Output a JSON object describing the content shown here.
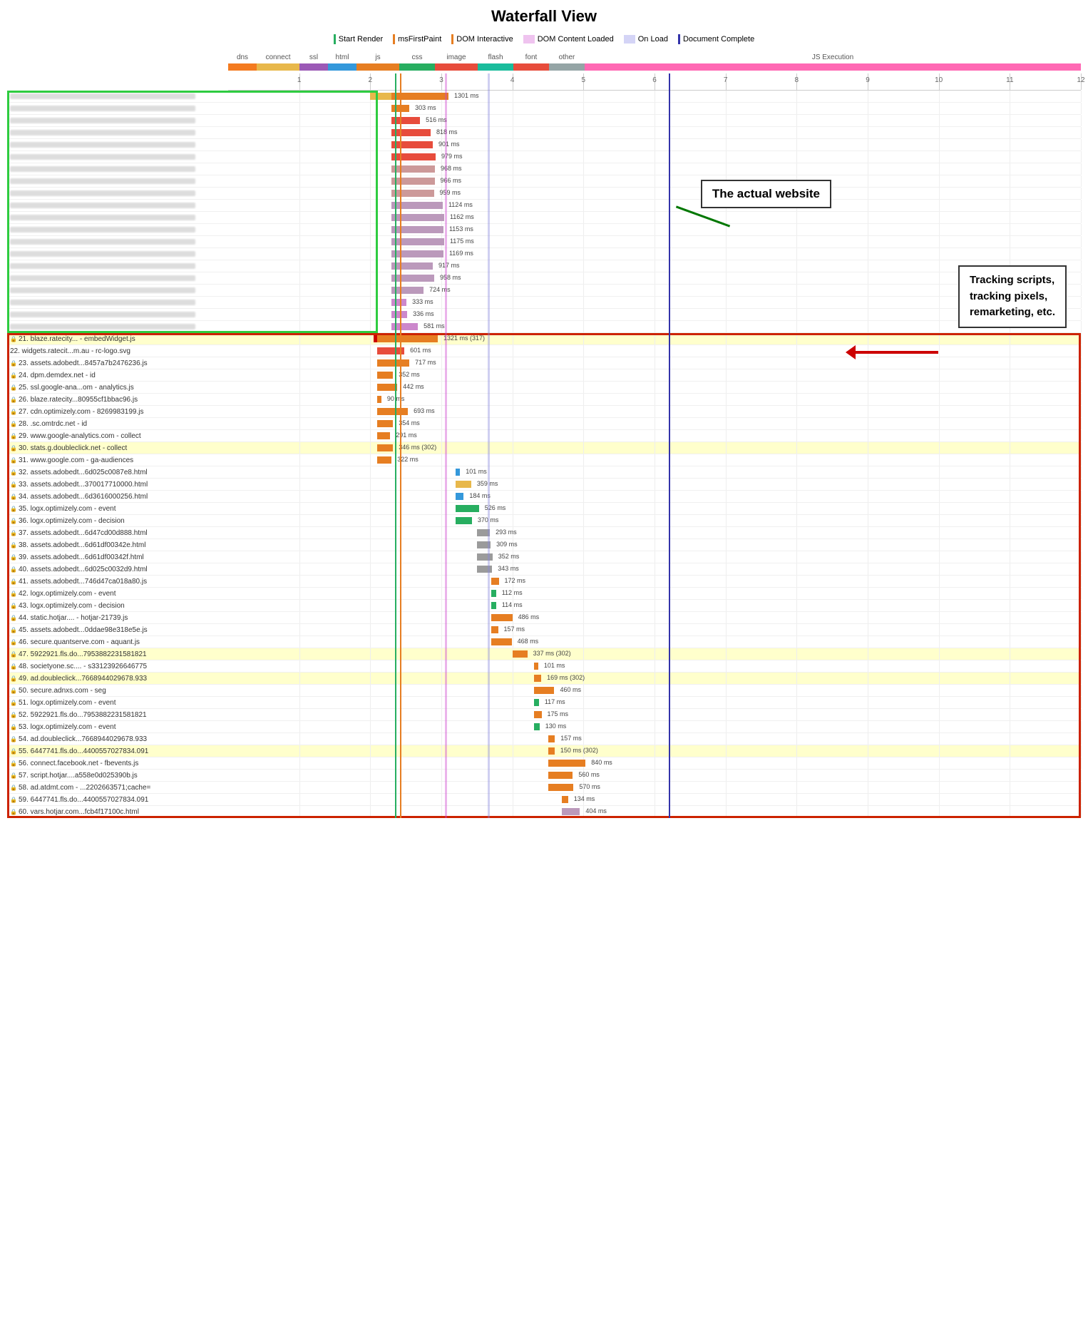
{
  "title": "Waterfall View",
  "legend": {
    "items": [
      {
        "label": "Start Render",
        "color": "#27ae60",
        "type": "line"
      },
      {
        "label": "msFirstPaint",
        "color": "#e67e22",
        "type": "line"
      },
      {
        "label": "DOM Interactive",
        "color": "#e67e22",
        "type": "line"
      },
      {
        "label": "DOM Content Loaded",
        "color": "#cc44cc",
        "type": "block"
      },
      {
        "label": "On Load",
        "color": "#8888dd",
        "type": "block"
      },
      {
        "label": "Document Complete",
        "color": "#3333aa",
        "type": "line"
      }
    ]
  },
  "columns": {
    "type_headers": [
      "dns",
      "connect",
      "ssl",
      "html",
      "js",
      "css",
      "image",
      "flash",
      "font",
      "other",
      "JS Execution"
    ]
  },
  "timeline": {
    "ticks": [
      1,
      2,
      3,
      4,
      5,
      6,
      7,
      8,
      9,
      10,
      11,
      12
    ],
    "total_seconds": 12
  },
  "annotations": {
    "actual_website": "The actual website",
    "tracking": "Tracking scripts,\ntracking pixels,\nremarketing, etc."
  },
  "rows": [
    {
      "id": 1,
      "url": "",
      "lock": false,
      "bg": "white",
      "bars": [
        {
          "type": "connect",
          "start": 2.0,
          "width": 0.3,
          "color": "#e8b84b"
        },
        {
          "type": "js",
          "start": 2.3,
          "width": 0.8,
          "color": "#e67e22"
        }
      ],
      "label": "1301 ms"
    },
    {
      "id": 2,
      "url": "",
      "lock": false,
      "bg": "white",
      "bars": [
        {
          "type": "js",
          "start": 2.3,
          "width": 0.25,
          "color": "#e67e22"
        }
      ],
      "label": "303 ms"
    },
    {
      "id": 3,
      "url": "",
      "lock": false,
      "bg": "white",
      "bars": [
        {
          "type": "js",
          "start": 2.3,
          "width": 0.4,
          "color": "#e74c3c"
        }
      ],
      "label": "516 ms"
    },
    {
      "id": 4,
      "url": "",
      "lock": false,
      "bg": "white",
      "bars": [
        {
          "type": "js",
          "start": 2.3,
          "width": 0.55,
          "color": "#e74c3c"
        }
      ],
      "label": "818 ms"
    },
    {
      "id": 5,
      "url": "",
      "lock": false,
      "bg": "white",
      "bars": [
        {
          "type": "js",
          "start": 2.3,
          "width": 0.58,
          "color": "#e74c3c"
        }
      ],
      "label": "901 ms"
    },
    {
      "id": 6,
      "url": "",
      "lock": false,
      "bg": "white",
      "bars": [
        {
          "type": "js",
          "start": 2.3,
          "width": 0.62,
          "color": "#e74c3c"
        }
      ],
      "label": "979 ms"
    },
    {
      "id": 7,
      "url": "",
      "lock": false,
      "bg": "white",
      "bars": [
        {
          "type": "js",
          "start": 2.3,
          "width": 0.61,
          "color": "#cc9999"
        }
      ],
      "label": "968 ms"
    },
    {
      "id": 8,
      "url": "",
      "lock": false,
      "bg": "white",
      "bars": [
        {
          "type": "js",
          "start": 2.3,
          "width": 0.605,
          "color": "#cc9999"
        }
      ],
      "label": "966 ms"
    },
    {
      "id": 9,
      "url": "",
      "lock": false,
      "bg": "white",
      "bars": [
        {
          "type": "js",
          "start": 2.3,
          "width": 0.595,
          "color": "#cc9999"
        }
      ],
      "label": "959 ms"
    },
    {
      "id": 10,
      "url": "",
      "lock": false,
      "bg": "white",
      "bars": [
        {
          "type": "js",
          "start": 2.3,
          "width": 0.72,
          "color": "#bb99bb"
        }
      ],
      "label": "1124 ms"
    },
    {
      "id": 11,
      "url": "",
      "lock": false,
      "bg": "white",
      "bars": [
        {
          "type": "js",
          "start": 2.3,
          "width": 0.74,
          "color": "#bb99bb"
        }
      ],
      "label": "1162 ms"
    },
    {
      "id": 12,
      "url": "",
      "lock": false,
      "bg": "white",
      "bars": [
        {
          "type": "js",
          "start": 2.3,
          "width": 0.73,
          "color": "#bb99bb"
        }
      ],
      "label": "1153 ms"
    },
    {
      "id": 13,
      "url": "",
      "lock": false,
      "bg": "white",
      "bars": [
        {
          "type": "js",
          "start": 2.3,
          "width": 0.74,
          "color": "#bb99bb"
        }
      ],
      "label": "1175 ms"
    },
    {
      "id": 14,
      "url": "",
      "lock": false,
      "bg": "white",
      "bars": [
        {
          "type": "js",
          "start": 2.3,
          "width": 0.73,
          "color": "#bb99bb"
        }
      ],
      "label": "1169 ms"
    },
    {
      "id": 15,
      "url": "",
      "lock": false,
      "bg": "white",
      "bars": [
        {
          "type": "js",
          "start": 2.3,
          "width": 0.58,
          "color": "#bb99bb"
        }
      ],
      "label": "917 ms"
    },
    {
      "id": 16,
      "url": "",
      "lock": false,
      "bg": "white",
      "bars": [
        {
          "type": "js",
          "start": 2.3,
          "width": 0.6,
          "color": "#bb99bb"
        }
      ],
      "label": "958 ms"
    },
    {
      "id": 17,
      "url": "",
      "lock": false,
      "bg": "white",
      "bars": [
        {
          "type": "js",
          "start": 2.3,
          "width": 0.45,
          "color": "#bb99bb"
        }
      ],
      "label": "724 ms"
    },
    {
      "id": 18,
      "url": "",
      "lock": false,
      "bg": "white",
      "bars": [
        {
          "type": "js",
          "start": 2.3,
          "width": 0.21,
          "color": "#cc88cc"
        }
      ],
      "label": "333 ms"
    },
    {
      "id": 19,
      "url": "",
      "lock": false,
      "bg": "white",
      "bars": [
        {
          "type": "js",
          "start": 2.3,
          "width": 0.22,
          "color": "#cc88cc"
        }
      ],
      "label": "336 ms"
    },
    {
      "id": 20,
      "url": "",
      "lock": false,
      "bg": "white",
      "bars": [
        {
          "type": "js",
          "start": 2.3,
          "width": 0.37,
          "color": "#cc88cc"
        }
      ],
      "label": "581 ms"
    },
    {
      "id": 21,
      "url": "21. blaze.ratecity... - embedWidget.js",
      "lock": true,
      "bg": "yellow",
      "bars": [
        {
          "type": "red",
          "start": 2.05,
          "width": 0.05,
          "color": "#cc0000"
        },
        {
          "type": "js",
          "start": 2.1,
          "width": 0.85,
          "color": "#e67e22"
        }
      ],
      "label": "1321 ms (317)"
    },
    {
      "id": 22,
      "url": "22. widgets.ratecit...m.au - rc-logo.svg",
      "lock": false,
      "bg": "white",
      "bars": [
        {
          "type": "img",
          "start": 2.1,
          "width": 0.38,
          "color": "#e74c3c"
        }
      ],
      "label": "601 ms"
    },
    {
      "id": 23,
      "url": "23. assets.adobedt...8457a7b2476236.js",
      "lock": true,
      "bg": "white",
      "bars": [
        {
          "type": "js",
          "start": 2.1,
          "width": 0.45,
          "color": "#e67e22"
        }
      ],
      "label": "717 ms"
    },
    {
      "id": 24,
      "url": "24. dpm.demdex.net - id",
      "lock": true,
      "bg": "white",
      "bars": [
        {
          "type": "js",
          "start": 2.1,
          "width": 0.22,
          "color": "#e67e22"
        }
      ],
      "label": "352 ms"
    },
    {
      "id": 25,
      "url": "25. ssl.google-ana...om - analytics.js",
      "lock": true,
      "bg": "white",
      "bars": [
        {
          "type": "js",
          "start": 2.1,
          "width": 0.28,
          "color": "#e67e22"
        }
      ],
      "label": "442 ms"
    },
    {
      "id": 26,
      "url": "26. blaze.ratecity...80955cf1bbac96.js",
      "lock": true,
      "bg": "white",
      "bars": [
        {
          "type": "js",
          "start": 2.1,
          "width": 0.056,
          "color": "#e67e22"
        }
      ],
      "label": "90 ms"
    },
    {
      "id": 27,
      "url": "27. cdn.optimizely.com - 8269983199.js",
      "lock": true,
      "bg": "white",
      "bars": [
        {
          "type": "js",
          "start": 2.1,
          "width": 0.43,
          "color": "#e67e22"
        }
      ],
      "label": "693 ms"
    },
    {
      "id": 28,
      "url": "28.         .sc.omtrdc.net - id",
      "lock": true,
      "bg": "white",
      "bars": [
        {
          "type": "js",
          "start": 2.1,
          "width": 0.22,
          "color": "#e67e22"
        }
      ],
      "label": "354 ms"
    },
    {
      "id": 29,
      "url": "29. www.google-analytics.com - collect",
      "lock": true,
      "bg": "white",
      "bars": [
        {
          "type": "js",
          "start": 2.1,
          "width": 0.18,
          "color": "#e67e22"
        }
      ],
      "label": "291 ms"
    },
    {
      "id": 30,
      "url": "30. stats.g.doubleclick.net - collect",
      "lock": true,
      "bg": "yellow",
      "bars": [
        {
          "type": "js",
          "start": 2.1,
          "width": 0.22,
          "color": "#e67e22"
        }
      ],
      "label": "346 ms (302)"
    },
    {
      "id": 31,
      "url": "31. www.google.com - ga-audiences",
      "lock": true,
      "bg": "white",
      "bars": [
        {
          "type": "js",
          "start": 2.1,
          "width": 0.2,
          "color": "#e67e22"
        }
      ],
      "label": "322 ms"
    },
    {
      "id": 32,
      "url": "32. assets.adobedt...6d025c0087e8.html",
      "lock": true,
      "bg": "white",
      "bars": [
        {
          "type": "html",
          "start": 3.2,
          "width": 0.063,
          "color": "#3498db"
        }
      ],
      "label": "101 ms"
    },
    {
      "id": 33,
      "url": "33. assets.adobedt...370017710000.html",
      "lock": true,
      "bg": "white",
      "bars": [
        {
          "type": "img",
          "start": 3.2,
          "width": 0.22,
          "color": "#e8b84b"
        }
      ],
      "label": "359 ms"
    },
    {
      "id": 34,
      "url": "34. assets.adobedt...6d3616000256.html",
      "lock": true,
      "bg": "white",
      "bars": [
        {
          "type": "html",
          "start": 3.2,
          "width": 0.115,
          "color": "#3498db"
        }
      ],
      "label": "184 ms"
    },
    {
      "id": 35,
      "url": "35. logx.optimizely.com - event",
      "lock": true,
      "bg": "white",
      "bars": [
        {
          "type": "js",
          "start": 3.2,
          "width": 0.33,
          "color": "#27ae60"
        }
      ],
      "label": "526 ms"
    },
    {
      "id": 36,
      "url": "36. logx.optimizely.com - decision",
      "lock": true,
      "bg": "white",
      "bars": [
        {
          "type": "js",
          "start": 3.2,
          "width": 0.23,
          "color": "#27ae60"
        }
      ],
      "label": "370 ms"
    },
    {
      "id": 37,
      "url": "37. assets.adobedt...6d47cd00d888.html",
      "lock": true,
      "bg": "white",
      "bars": [
        {
          "type": "html",
          "start": 3.5,
          "width": 0.184,
          "color": "#9b9b9b"
        }
      ],
      "label": "293 ms"
    },
    {
      "id": 38,
      "url": "38. assets.adobedt...6d61df00342e.html",
      "lock": true,
      "bg": "white",
      "bars": [
        {
          "type": "html",
          "start": 3.5,
          "width": 0.194,
          "color": "#9b9b9b"
        }
      ],
      "label": "309 ms"
    },
    {
      "id": 39,
      "url": "39. assets.adobedt...6d61df00342f.html",
      "lock": true,
      "bg": "white",
      "bars": [
        {
          "type": "html",
          "start": 3.5,
          "width": 0.22,
          "color": "#9b9b9b"
        }
      ],
      "label": "352 ms"
    },
    {
      "id": 40,
      "url": "40. assets.adobedt...6d025c0032d9.html",
      "lock": true,
      "bg": "white",
      "bars": [
        {
          "type": "html",
          "start": 3.5,
          "width": 0.215,
          "color": "#9b9b9b"
        }
      ],
      "label": "343 ms"
    },
    {
      "id": 41,
      "url": "41. assets.adobedt...746d47ca018a80.js",
      "lock": true,
      "bg": "white",
      "bars": [
        {
          "type": "js",
          "start": 3.7,
          "width": 0.108,
          "color": "#e67e22"
        }
      ],
      "label": "172 ms"
    },
    {
      "id": 42,
      "url": "42. logx.optimizely.com - event",
      "lock": true,
      "bg": "white",
      "bars": [
        {
          "type": "js",
          "start": 3.7,
          "width": 0.07,
          "color": "#27ae60"
        }
      ],
      "label": "112 ms"
    },
    {
      "id": 43,
      "url": "43. logx.optimizely.com - decision",
      "lock": true,
      "bg": "white",
      "bars": [
        {
          "type": "js",
          "start": 3.7,
          "width": 0.071,
          "color": "#27ae60"
        }
      ],
      "label": "114 ms"
    },
    {
      "id": 44,
      "url": "44. static.hotjar.... - hotjar-21739.js",
      "lock": true,
      "bg": "white",
      "bars": [
        {
          "type": "js",
          "start": 3.7,
          "width": 0.3,
          "color": "#e67e22"
        }
      ],
      "label": "486 ms"
    },
    {
      "id": 45,
      "url": "45. assets.adobedt...0ddae98e318e5e.js",
      "lock": true,
      "bg": "white",
      "bars": [
        {
          "type": "js",
          "start": 3.7,
          "width": 0.098,
          "color": "#e67e22"
        }
      ],
      "label": "157 ms"
    },
    {
      "id": 46,
      "url": "46. secure.quantserve.com - aquant.js",
      "lock": true,
      "bg": "white",
      "bars": [
        {
          "type": "js",
          "start": 3.7,
          "width": 0.29,
          "color": "#e67e22"
        }
      ],
      "label": "468 ms"
    },
    {
      "id": 47,
      "url": "47. 5922921.fls.do...7953882231581821",
      "lock": true,
      "bg": "yellow",
      "bars": [
        {
          "type": "js",
          "start": 4.0,
          "width": 0.21,
          "color": "#e67e22"
        }
      ],
      "label": "337 ms (302)"
    },
    {
      "id": 48,
      "url": "48. societyone.sc.... - s33123926646775",
      "lock": true,
      "bg": "white",
      "bars": [
        {
          "type": "js",
          "start": 4.3,
          "width": 0.063,
          "color": "#e67e22"
        }
      ],
      "label": "101 ms"
    },
    {
      "id": 49,
      "url": "49. ad.doubleclick...7668944029678.933",
      "lock": true,
      "bg": "yellow",
      "bars": [
        {
          "type": "js",
          "start": 4.3,
          "width": 0.106,
          "color": "#e67e22"
        }
      ],
      "label": "169 ms (302)"
    },
    {
      "id": 50,
      "url": "50. secure.adnxs.com - seg",
      "lock": true,
      "bg": "white",
      "bars": [
        {
          "type": "js",
          "start": 4.3,
          "width": 0.29,
          "color": "#e67e22"
        }
      ],
      "label": "460 ms"
    },
    {
      "id": 51,
      "url": "51. logx.optimizely.com - event",
      "lock": true,
      "bg": "white",
      "bars": [
        {
          "type": "js",
          "start": 4.3,
          "width": 0.073,
          "color": "#27ae60"
        }
      ],
      "label": "117 ms"
    },
    {
      "id": 52,
      "url": "52. 5922921.fls.do...7953882231581821",
      "lock": true,
      "bg": "white",
      "bars": [
        {
          "type": "js",
          "start": 4.3,
          "width": 0.11,
          "color": "#e67e22"
        }
      ],
      "label": "175 ms"
    },
    {
      "id": 53,
      "url": "53. logx.optimizely.com - event",
      "lock": true,
      "bg": "white",
      "bars": [
        {
          "type": "js",
          "start": 4.3,
          "width": 0.082,
          "color": "#27ae60"
        }
      ],
      "label": "130 ms"
    },
    {
      "id": 54,
      "url": "54. ad.doubleclick...7668944029678.933",
      "lock": true,
      "bg": "white",
      "bars": [
        {
          "type": "js",
          "start": 4.5,
          "width": 0.098,
          "color": "#e67e22"
        }
      ],
      "label": "157 ms"
    },
    {
      "id": 55,
      "url": "55. 6447741.fls.do...4400557027834.091",
      "lock": true,
      "bg": "yellow",
      "bars": [
        {
          "type": "js",
          "start": 4.5,
          "width": 0.094,
          "color": "#e67e22"
        }
      ],
      "label": "150 ms (302)"
    },
    {
      "id": 56,
      "url": "56. connect.facebook.net - fbevents.js",
      "lock": true,
      "bg": "white",
      "bars": [
        {
          "type": "js",
          "start": 4.5,
          "width": 0.53,
          "color": "#e67e22"
        }
      ],
      "label": "840 ms"
    },
    {
      "id": 57,
      "url": "57. script.hotjar....a558e0d025390b.js",
      "lock": true,
      "bg": "white",
      "bars": [
        {
          "type": "js",
          "start": 4.5,
          "width": 0.35,
          "color": "#e67e22"
        }
      ],
      "label": "560 ms"
    },
    {
      "id": 58,
      "url": "58. ad.atdmt.com - ...2202663571;cache=",
      "lock": true,
      "bg": "white",
      "bars": [
        {
          "type": "js",
          "start": 4.5,
          "width": 0.36,
          "color": "#e67e22"
        }
      ],
      "label": "570 ms"
    },
    {
      "id": 59,
      "url": "59. 6447741.fls.do...4400557027834.091",
      "lock": true,
      "bg": "white",
      "bars": [
        {
          "type": "js",
          "start": 4.7,
          "width": 0.084,
          "color": "#e67e22"
        }
      ],
      "label": "134 ms"
    },
    {
      "id": 60,
      "url": "60. vars.hotjar.com...fcb4f17100c.html",
      "lock": true,
      "bg": "white",
      "bars": [
        {
          "type": "js",
          "start": 4.7,
          "width": 0.25,
          "color": "#bb99bb"
        }
      ],
      "label": "404 ms"
    }
  ]
}
